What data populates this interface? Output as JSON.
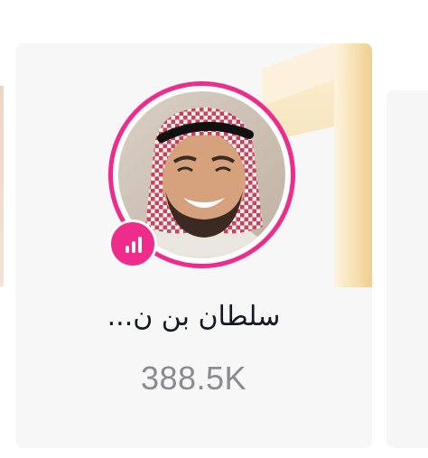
{
  "card": {
    "name": "سلطان بن ن...",
    "count": "388.5K",
    "rank": "1",
    "is_live": true
  },
  "colors": {
    "accent_pink": "#ee2c8c",
    "rank_gold_light": "#fbeed2",
    "rank_gold_dark": "#ebc47e",
    "card_bg": "#f7f7f7",
    "name_text": "#161823",
    "count_text": "#8a8b91"
  },
  "icons": {
    "live_badge": "live-bars-icon",
    "avatar": "avatar-photo"
  }
}
